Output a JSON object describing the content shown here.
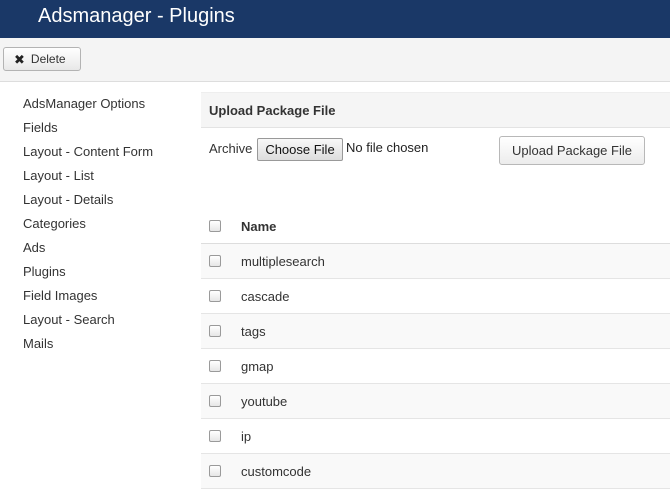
{
  "header": {
    "title": "Adsmanager - Plugins"
  },
  "toolbar": {
    "delete_label": "Delete"
  },
  "sidebar": {
    "items": [
      {
        "label": "AdsManager Options"
      },
      {
        "label": "Fields"
      },
      {
        "label": "Layout - Content Form"
      },
      {
        "label": "Layout - List"
      },
      {
        "label": "Layout - Details"
      },
      {
        "label": "Categories"
      },
      {
        "label": "Ads"
      },
      {
        "label": "Plugins"
      },
      {
        "label": "Field Images"
      },
      {
        "label": "Layout - Search"
      },
      {
        "label": "Mails"
      }
    ]
  },
  "upload": {
    "title": "Upload Package File",
    "archive_label": "Archive",
    "choose_file_label": "Choose File",
    "file_status": "No file chosen",
    "upload_button_label": "Upload Package File"
  },
  "table": {
    "header_name": "Name",
    "rows": [
      {
        "name": "multiplesearch"
      },
      {
        "name": "cascade"
      },
      {
        "name": "tags"
      },
      {
        "name": "gmap"
      },
      {
        "name": "youtube"
      },
      {
        "name": "ip"
      },
      {
        "name": "customcode"
      }
    ]
  }
}
